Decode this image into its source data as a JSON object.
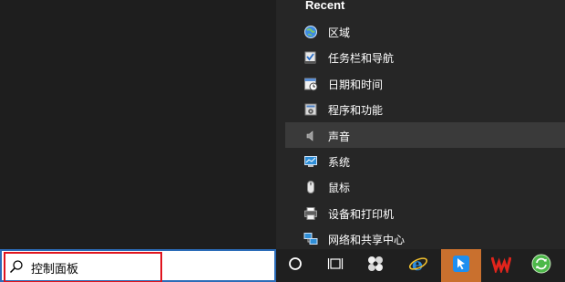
{
  "recent": {
    "title": "Recent",
    "items": [
      {
        "label": "区域",
        "icon": "region-icon"
      },
      {
        "label": "任务栏和导航",
        "icon": "taskbar-navigation-icon"
      },
      {
        "label": "日期和时间",
        "icon": "date-time-icon"
      },
      {
        "label": "程序和功能",
        "icon": "programs-features-icon"
      },
      {
        "label": "声音",
        "icon": "sound-icon"
      },
      {
        "label": "系统",
        "icon": "system-icon"
      },
      {
        "label": "鼠标",
        "icon": "mouse-icon"
      },
      {
        "label": "设备和打印机",
        "icon": "devices-printers-icon"
      },
      {
        "label": "网络和共享中心",
        "icon": "network-sharing-icon"
      }
    ]
  },
  "search": {
    "value": "控制面板",
    "icon": "search-icon"
  },
  "taskbar": {
    "buttons": [
      {
        "icon": "cortana-circle-icon"
      },
      {
        "icon": "task-view-icon"
      },
      {
        "icon": "pinwheel-app-icon"
      },
      {
        "icon": "internet-explorer-icon"
      },
      {
        "icon": "blue-arrow-app-icon"
      },
      {
        "icon": "wps-office-icon"
      },
      {
        "icon": "green-refresh-app-icon"
      }
    ]
  },
  "colors": {
    "accent_highlight": "#e0141e",
    "search_border": "#2b6cb8",
    "active_taskbar": "#c9702e"
  }
}
